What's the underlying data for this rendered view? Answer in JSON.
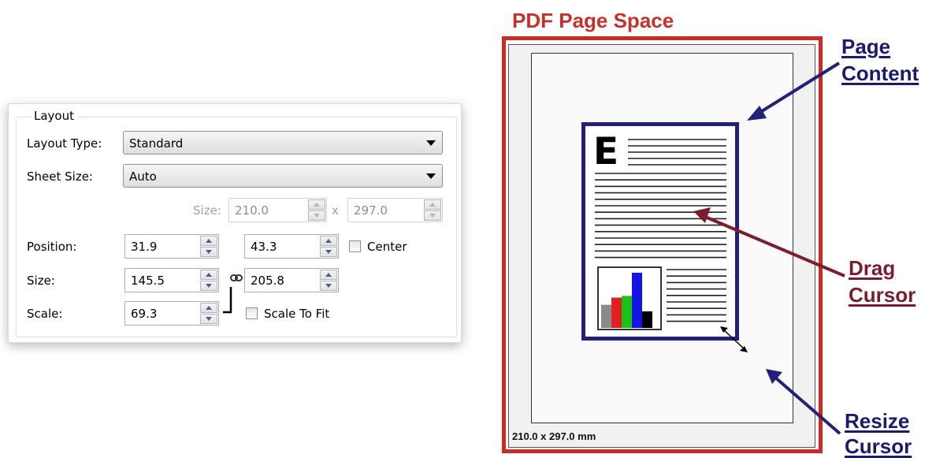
{
  "layout_panel": {
    "group_title": "Layout",
    "layout_type": {
      "label": "Layout Type:",
      "value": "Standard"
    },
    "sheet_size": {
      "label": "Sheet Size:",
      "value": "Auto"
    },
    "sheet_dims": {
      "label": "Size:",
      "width": "210.0",
      "separator": "x",
      "height": "297.0"
    },
    "position": {
      "label": "Position:",
      "x": "31.9",
      "y": "43.3",
      "center_label": "Center",
      "center_checked": false
    },
    "size": {
      "label": "Size:",
      "width": "145.5",
      "height": "205.8"
    },
    "scale": {
      "label": "Scale:",
      "value": "69.3",
      "fit_label": "Scale To Fit",
      "fit_checked": false
    }
  },
  "diagram": {
    "title": "PDF Page Space",
    "page_content_label": [
      "Page",
      "Content"
    ],
    "drag_cursor_label": [
      "Drag",
      "Cursor"
    ],
    "resize_cursor_label": [
      "Resize",
      "Cursor"
    ],
    "dimension_text": "210.0 x 297.0 mm",
    "icon_letter": "E",
    "colors": {
      "title": "#c8302c",
      "page_border": "#cc2a22",
      "content_border": "#23207a",
      "blue_text": "#1b1b6e",
      "maroon_text": "#7b1d2e"
    },
    "mini_chart": {
      "bar_colors": [
        "#8a8a8a",
        "#e02020",
        "#18c418",
        "#1414e6",
        "#000000"
      ],
      "relative_heights": [
        0.42,
        0.55,
        0.58,
        1.0,
        0.3
      ]
    }
  }
}
